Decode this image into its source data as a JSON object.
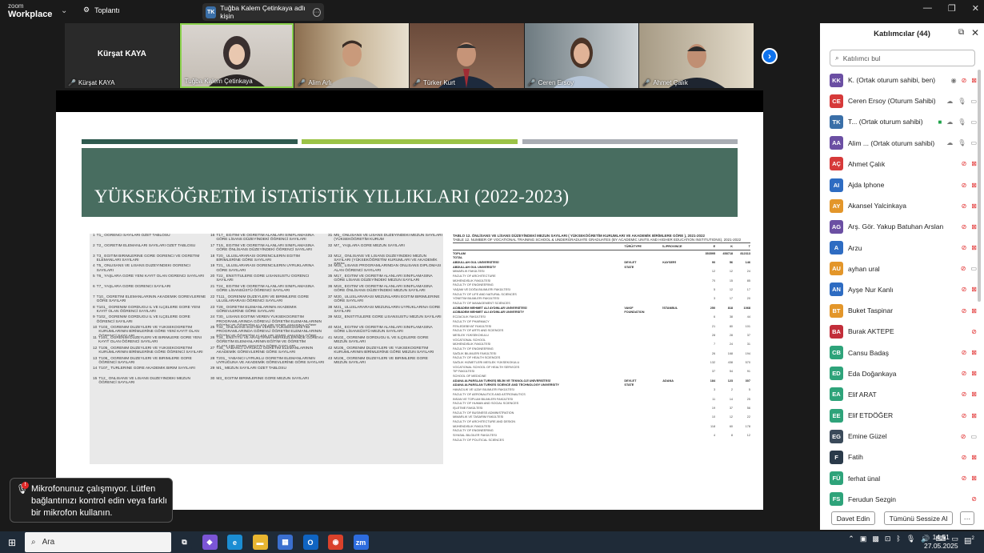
{
  "app": {
    "brand_top": "zoom",
    "brand_bottom": "Workplace",
    "meeting_label": "Toplantı",
    "share_badge": "TK",
    "share_title": "Tuğba Kalem Çetinkaya adlı kişin"
  },
  "video_strip": {
    "tiles": [
      {
        "big_name": "Kürşat KAYA",
        "name": "Kürşat KAYA",
        "type": "name-only"
      },
      {
        "big_name": "",
        "name": "Tuğba Kalem Çetinkaya",
        "type": "video",
        "active": true
      },
      {
        "big_name": "",
        "name": "Alim Arlı",
        "type": "video"
      },
      {
        "big_name": "",
        "name": "Türker Kurt",
        "type": "video"
      },
      {
        "big_name": "",
        "name": "Ceren Ersoy",
        "type": "video"
      },
      {
        "big_name": "",
        "name": "Ahmet Çalık",
        "type": "video"
      }
    ]
  },
  "slide": {
    "title": "YÜKSEKÖĞRETİM İSTATİSTİK YILLIKLARI (2022-2023)",
    "bar_colors": [
      "#2f5a4f",
      "#9bc346",
      "#a9adb3"
    ],
    "toc": [
      [
        "1",
        "T1_ ÖĞRENCİ SAYILARI ÖZET TABLOSU"
      ],
      [
        "2",
        "T2_ ÖĞRETİM ELEMANLARI SAYILARI ÖZET TABLOSU"
      ],
      [
        "3",
        "T3_ EĞİTİM BİRİMLERİNE GÖRE ÖĞRENCİ VE ÖĞRETİM ELEMANLARI SAYILARI"
      ],
      [
        "4",
        "T5_ ÖNLİSANS VE LİSANS DÜZEYİNDEKİ ÖĞRENCİ SAYILARI"
      ],
      [
        "5",
        "T6_ YAŞLARA GÖRE YENİ KAYIT OLAN ÖĞRENCİ SAYILARI"
      ],
      [
        "6",
        "T7_ YAŞLARA GÖRE ÖĞRENCİ SAYILARI"
      ],
      [
        "7",
        "T10_ ÖĞRETİM ELEMANLARININ AKADEMİK GÖREVLERİNE GÖRE SAYILARI"
      ],
      [
        "8",
        "T101_ ÖĞRENİM GÖRDÜĞÜ İL VE İLÇELERE GÖRE YENİ KAYIT OLAN ÖĞRENCİ SAYILARI"
      ],
      [
        "9",
        "T102_ ÖĞRENİM GÖRDÜĞÜ İL VE İLÇELERE GÖRE ÖĞRENCİ SAYILARI"
      ],
      [
        "10",
        "T103_ ÖĞRENİM DÜZEYLERİ VE YÜKSEKÖĞRETİM KURUMLARININ BİRİMLERİNE GÖRE YENİ KAYIT OLAN ÖĞRENCİ SAYILARI"
      ],
      [
        "11",
        "T104_ ÖĞRENİM DÜZEYLERİ VE BİRİMLERE GÖRE YENİ KAYIT OLAN ÖĞRENCİ SAYILARI"
      ],
      [
        "12",
        "T105_ ÖĞRENİM DÜZEYLERİ VE YÜKSEKÖĞRETİM KURUMLARININ BİRİMLERİNE GÖRE ÖĞRENCİ SAYILARI"
      ],
      [
        "13",
        "T106_ ÖĞRENİM DÜZEYLERİ VE BİRİMLERE GÖRE ÖĞRENCİ SAYILARI"
      ],
      [
        "14",
        "T107_ TÜRLERİNE GÖRE AKADEMİK BİRİM SAYILARI"
      ],
      [
        "15",
        "T12_ ÖNLİSANS VE LİSANS DÜZEYİNDEKİ MEZUN ÖĞRENCİ SAYILARI"
      ],
      [
        "16",
        "T17_ EĞİTİM VE ÖĞRETİM ALANLARI SINIFLAMASINA GÖRE LİSANS DÜZEYİNDEKİ ÖĞRENCİ SAYILARI"
      ],
      [
        "17",
        "T19_ EĞİTİM VE ÖĞRETİM ALANLARI SINIFLAMASINA GÖRE ÖNLİSANS DÜZEYİNDEKİ ÖĞRENCİ SAYILARI"
      ],
      [
        "18",
        "T20_ ULUSLARARASI ÖĞRENCİLERİN EĞİTİM BİRİMLERİNE GÖRE SAYILARI"
      ],
      [
        "19",
        "T21_ ULUSLARARASI ÖĞRENCİLERİN UYRUKLARINA GÖRE SAYILARI"
      ],
      [
        "20",
        "T22_ ENSTİTÜLERE GÖRE LİSANSÜSTÜ ÖĞRENCİ SAYILARI"
      ],
      [
        "21",
        "T24_ EĞİTİM VE ÖĞRETİM ALANLARI SINIFLAMASINA GÖRE LİSANSÜSTÜ ÖĞRENCİ SAYILARI"
      ],
      [
        "22",
        "T111_ ÖĞRENİM DÜZEYLERİ VE BİRİMLERE GÖRE ULUSLARARASI ÖĞRENCİ SAYILARI"
      ],
      [
        "23",
        "T28_ ÖĞRETİM ELEMANLARININ AKADEMİK GÖREVLERİNE GÖRE SAYILARI"
      ],
      [
        "24",
        "T30_ LİSANS EĞİTİMİ VEREN YÜKSEKÖĞRETİM PROGRAMLARINDA GÖREVLİ ÖĞRETİM ELEMANLARININ EĞİTİM VE ÖĞRETİM ALANLARI SINIFLAMASINA GÖRE SAYILARI"
      ],
      [
        "25",
        "T32_ ÖNLİSANS EĞİTİMİ VEREN YÜKSEKÖĞRETİM PROGRAMLARINDA GÖREVLİ ÖĞRETİM ELEMANLARININ EĞİTİM VE ÖĞRETİM ALANLARI SINIFLAMASINA GÖRE SAYILARI"
      ],
      [
        "26",
        "T34_ ENSTİTÜ VE ARAŞTIRMA MERKEZLERİNDE GÖREVLİ ÖĞRETİM ELEMANLARININ EĞİTİM VE ÖĞRETİM ALANLARI SINIFLAMASINA GÖRE SAYILARI"
      ],
      [
        "27",
        "T35_ YABANCI UYRUKLU ÖĞRETİM ELEMANLARININ AKADEMİK GÖREVLERİNE GÖRE SAYILARI"
      ],
      [
        "28",
        "T201_ YABANCI UYRUKLU ÖĞRETİM ELEMANLARININ UYRUĞUNA VE AKADEMİK GÖREVLERİNE GÖRE SAYILARI"
      ],
      [
        "29",
        "M1_ MEZUN SAYILARI ÖZET TABLOSU"
      ],
      [
        "30",
        "M3_ EĞİTİM BİRİMLERİNE GÖRE MEZUN SAYILARI"
      ],
      [
        "31",
        "M5_ ÖNLİSANS VE LİSANS DÜZEYİNDEKİ MEZUN SAYILARI (YÜKSEKÖĞRETİM KURUM"
      ],
      [
        "32",
        "M7_ YAŞLARA GÖRE MEZUN SAYILARI"
      ],
      [
        "33",
        "M12_ ÖNLİSANS VE LİSANS DÜZEYİNDEKİ MEZUN SAYILARI (YÜKSEKÖĞRETİM KURUMLARI VE AKADEMİK BİRİM"
      ],
      [
        "34",
        "M15_ LİSANS PROGRAMLARINDAN ÖNLİSANS DİPLOMASI ALAN ÖĞRENCİ SAYILARI"
      ],
      [
        "35",
        "M17_ EĞİTİM VE ÖĞRETİM ALANLARI SINIFLAMASINA GÖRE LİSANS DÜZEYİNDEKİ MEZUN SAYILARI"
      ],
      [
        "36",
        "M19_ EĞİTİM VE ÖĞRETİM ALANLARI SINIFLAMASINA GÖRE ÖNLİSANS DÜZEYİNDEKİ MEZUN SAYILARI"
      ],
      [
        "37",
        "M20_ ULUSLARARASI MEZUNLARIN EĞİTİM BİRİMLERİNE GÖRE SAYILARI"
      ],
      [
        "38",
        "M21_ ULUSLARARASI MEZUNLARIN UYRUKLARINA GÖRE SAYILARI"
      ],
      [
        "39",
        "M22_ ENSTİTÜLERE GÖRE LİSANSÜSTÜ MEZUN SAYILARI"
      ],
      [
        "40",
        "M24_ EĞİTİM VE ÖĞRETİM ALANLARI SINIFLAMASINA GÖRE LİSANSÜSTÜ MEZUN SAYILARI"
      ],
      [
        "41",
        "M102_ ÖĞRENİM GÖRDÜĞÜ İL VE İLÇELERE GÖRE MEZUN SAYILARI"
      ],
      [
        "42",
        "M105_ ÖĞRENİM DÜZEYLERİ VE YÜKSEKÖĞRETİM KURUMLARININ BİRİMLERİNE GÖRE MEZUN SAYILARI"
      ],
      [
        "43",
        "M106_ ÖĞRENİM DÜZEYLERİ VE BİRİMLERE GÖRE MEZUN SAYILARI"
      ]
    ],
    "stats_title_tr": "TABLO 12. ÖNLİSANS VE LİSANS DÜZEYİNDEKİ MEZUN SAYILARI ( YÜKSEKÖĞRETİM KURUMLARI VE AKADEMİK BİRİMLERE GÖRE ), 2021-2022",
    "stats_title_en": "TABLE 12. NUMBER OF VOCATIONAL TRAINING SCHOOL & UNDERGRADUATE GRADUATES (BY ACADEMIC UNITS AND HIGHER EDUCATION INSTITUTIONS), 2021-2022",
    "stats_headers": [
      "",
      "TÜRÜ/TYPE",
      "İL/PROVINCE",
      "E",
      "K",
      "T"
    ],
    "stats_rows": [
      {
        "c": [
          "TOPLAM",
          "",
          "",
          "353595",
          "458718",
          "812313"
        ],
        "hl": true
      },
      {
        "c": [
          "TOTAL",
          "",
          "",
          "",
          "",
          ""
        ],
        "hl": true
      },
      {
        "c": [
          "ABDULLAH GÜL ÜNİVERSİTESİ",
          "DEVLET",
          "KAYSERİ",
          "90",
          "56",
          "146"
        ],
        "hl": true
      },
      {
        "c": [
          "ABDULLAH GUL UNIVERSITY",
          "STATE",
          "",
          "",
          "",
          ""
        ],
        "hl": true
      },
      {
        "c": [
          "MİMARLIK FAKÜLTESİ",
          "",
          "",
          "12",
          "12",
          "24"
        ]
      },
      {
        "c": [
          "FACULTY OF ARCHITECTURE",
          "",
          "",
          "",
          "",
          ""
        ]
      },
      {
        "c": [
          "MÜHENDİSLİK FAKÜLTESİ",
          "",
          "",
          "70",
          "15",
          "85"
        ]
      },
      {
        "c": [
          "FACULTY OF ENGINEERING",
          "",
          "",
          "",
          "",
          ""
        ]
      },
      {
        "c": [
          "YAŞAM VE DOĞA BİLİMLERİ FAKÜLTESİ",
          "",
          "",
          "5",
          "12",
          "17"
        ]
      },
      {
        "c": [
          "FACULTY OF LIFE AND NATURAL SCIENCES",
          "",
          "",
          "",
          "",
          ""
        ]
      },
      {
        "c": [
          "YÖNETİM BİLİMLERİ FAKÜLTESİ",
          "",
          "",
          "3",
          "17",
          "20"
        ]
      },
      {
        "c": [
          "FACULTY OF MANAGEMENT SCIENCES",
          "",
          "",
          "",
          "",
          ""
        ]
      },
      {
        "c": [
          "ACIBADEM MEHMET ALİ AYDINLAR ÜNİVERSİTESİ",
          "VAKIF",
          "İSTANBUL",
          "250",
          "818",
          "1068"
        ],
        "hl": true
      },
      {
        "c": [
          "ACIBADEM MEHMET ALI AYDINLAR UNIVERSITY",
          "FOUNDATION",
          "",
          "",
          "",
          ""
        ],
        "hl": true
      },
      {
        "c": [
          "ECZACILIK FAKÜLTESİ",
          "",
          "",
          "6",
          "38",
          "44"
        ]
      },
      {
        "c": [
          "FACULTY OF PHARMACY",
          "",
          "",
          "",
          "",
          ""
        ]
      },
      {
        "c": [
          "FEN-EDEBİYAT FAKÜLTESİ",
          "",
          "",
          "21",
          "80",
          "101"
        ]
      },
      {
        "c": [
          "FACULTY OF ARTS AND SCIENCES",
          "",
          "",
          "",
          "",
          ""
        ]
      },
      {
        "c": [
          "MESLEK YÜKSEKOKULU",
          "",
          "",
          "28",
          "28",
          "37"
        ]
      },
      {
        "c": [
          "VOCATIONAL SCHOOL",
          "",
          "",
          "",
          "",
          ""
        ]
      },
      {
        "c": [
          "MÜHENDİSLİK FAKÜLTESİ",
          "",
          "",
          "7",
          "24",
          "31"
        ]
      },
      {
        "c": [
          "FACULTY OF ENGINEERING",
          "",
          "",
          "",
          "",
          ""
        ]
      },
      {
        "c": [
          "SAĞLIK BİLİMLERİ FAKÜLTESİ",
          "",
          "",
          "26",
          "168",
          "194"
        ]
      },
      {
        "c": [
          "FACULTY OF HEALTH SCIENCES",
          "",
          "",
          "",
          "",
          ""
        ]
      },
      {
        "c": [
          "SAĞLIK HİZMETLERİ MESLEK YÜKSEKOKULU",
          "",
          "",
          "132",
          "438",
          "570"
        ]
      },
      {
        "c": [
          "VOCATIONAL SCHOOL OF HEALTH SERVICES",
          "",
          "",
          "",
          "",
          ""
        ]
      },
      {
        "c": [
          "TIP FAKÜLTESİ",
          "",
          "",
          "37",
          "54",
          "91"
        ]
      },
      {
        "c": [
          "SCHOOL OF MEDICINE",
          "",
          "",
          "",
          "",
          ""
        ]
      },
      {
        "c": [
          "ADANA ALPARSLAN TÜRKEŞ BİLİM VE TEKNOLOJİ ÜNİVERSİTESİ",
          "DEVLET",
          "ADANA",
          "184",
          "123",
          "307"
        ],
        "hl": true
      },
      {
        "c": [
          "ADANA ALPARSLAN TURKES SCIENCE AND TECHNOLOGY UNIVERSITY",
          "STATE",
          "",
          "",
          "",
          ""
        ],
        "hl": true
      },
      {
        "c": [
          "HAVACILIK VE UZAY BİLİMLERİ FAKÜLTESİ",
          "",
          "",
          "3",
          "2",
          "5"
        ]
      },
      {
        "c": [
          "FACULTY OF AERONAUTICS AND ASTRONAUTICS",
          "",
          "",
          "",
          "",
          ""
        ]
      },
      {
        "c": [
          "İNSAN VE TOPLUM BİLİMLERİ FAKÜLTESİ",
          "",
          "",
          "11",
          "14",
          "25"
        ]
      },
      {
        "c": [
          "FACULTY OF HUMAN AND SOCIAL SCIENCES",
          "",
          "",
          "",
          "",
          ""
        ]
      },
      {
        "c": [
          "İŞLETME FAKÜLTESİ",
          "",
          "",
          "19",
          "37",
          "56"
        ]
      },
      {
        "c": [
          "FACULTY OF BUSINESS ADMINISTRATION",
          "",
          "",
          "",
          "",
          ""
        ]
      },
      {
        "c": [
          "MİMARLIK VE TASARIM FAKÜLTESİ",
          "",
          "",
          "10",
          "12",
          "22"
        ]
      },
      {
        "c": [
          "FACULTY OF ARCHITECTURE AND DESIGN",
          "",
          "",
          "",
          "",
          ""
        ]
      },
      {
        "c": [
          "MÜHENDİSLİK FAKÜLTESİ",
          "",
          "",
          "118",
          "60",
          "178"
        ]
      },
      {
        "c": [
          "FACULTY OF ENGINEERING",
          "",
          "",
          "",
          "",
          ""
        ]
      },
      {
        "c": [
          "SİYASAL BİLGİLER FAKÜLTESİ",
          "",
          "",
          "4",
          "8",
          "12"
        ]
      },
      {
        "c": [
          "FACULTY OF POLITICAL SCIENCES",
          "",
          "",
          "",
          "",
          ""
        ]
      }
    ]
  },
  "toast": {
    "badge": "!",
    "text": "Mikrofonunuz çalışmıyor. Lütfen bağlantınızı kontrol edin veya farklı bir mikrofon kullanın."
  },
  "participants": {
    "title": "Katılımcılar (44)",
    "search_placeholder": "Katılımcı bul",
    "items": [
      {
        "initials": "KK",
        "name": "K. (Ortak oturum sahibi, ben)",
        "color": "#6b4fa3",
        "icons": [
          "eye",
          "mute",
          "cam-off"
        ]
      },
      {
        "initials": "CE",
        "name": "Ceren Ersoy (Oturum Sahibi)",
        "color": "#d63a3a",
        "icons": [
          "cloud",
          "mic",
          "cam"
        ]
      },
      {
        "initials": "TK",
        "name": "T... (Ortak oturum sahibi)",
        "color": "#3a6fa8",
        "icons": [
          "share",
          "cloud",
          "mic",
          "cam"
        ]
      },
      {
        "initials": "AA",
        "name": "Alim ... (Ortak oturum sahibi)",
        "color": "#6b4fa3",
        "icons": [
          "cloud",
          "mic",
          "cam"
        ]
      },
      {
        "initials": "AÇ",
        "name": "Ahmet Çalık",
        "color": "#d63a3a",
        "icons": [
          "mute",
          "cam-off"
        ]
      },
      {
        "initials": "AI",
        "name": "Ajda Iphone",
        "color": "#2e6cc2",
        "icons": [
          "mute",
          "cam-off"
        ]
      },
      {
        "initials": "AY",
        "name": "Akansel Yalcinkaya",
        "color": "#e3962a",
        "icons": [
          "mute",
          "cam-off"
        ]
      },
      {
        "initials": "AG",
        "name": "Arş. Gör. Yakup Batuhan Arslan",
        "color": "#6b4fa3",
        "icons": [
          "mute",
          "cam-off"
        ]
      },
      {
        "initials": "A",
        "name": "Arzu",
        "color": "#2e6cc2",
        "icons": [
          "mute",
          "cam-off"
        ]
      },
      {
        "initials": "AU",
        "name": "ayhan ural",
        "color": "#e3962a",
        "icons": [
          "mute",
          "cam"
        ]
      },
      {
        "initials": "AN",
        "name": "Ayşe Nur Kanlı",
        "color": "#2e6cc2",
        "icons": [
          "mute",
          "cam-off"
        ]
      },
      {
        "initials": "BT",
        "name": "Buket Taspinar",
        "color": "#e3962a",
        "icons": [
          "mute",
          "cam-off"
        ]
      },
      {
        "initials": "BA",
        "name": "Burak AKTEPE",
        "color": "#c22e3a",
        "icons": [
          "mute"
        ]
      },
      {
        "initials": "CB",
        "name": "Cansu Badaş",
        "color": "#2ea37a",
        "icons": [
          "mute",
          "cam-off"
        ]
      },
      {
        "initials": "ED",
        "name": "Eda Doğankaya",
        "color": "#2ea37a",
        "icons": [
          "mute",
          "cam-off"
        ]
      },
      {
        "initials": "EA",
        "name": "Elif ARAT",
        "color": "#2ea37a",
        "icons": [
          "mute",
          "cam-off"
        ]
      },
      {
        "initials": "EE",
        "name": "Elif ETDÖĞER",
        "color": "#2ea37a",
        "icons": [
          "mute",
          "cam-off"
        ]
      },
      {
        "initials": "EG",
        "name": "Emine Güzel",
        "color": "#3a4a5a",
        "icons": [
          "mute",
          "cam"
        ]
      },
      {
        "initials": "F",
        "name": "Fatih",
        "color": "#2a3a4a",
        "icons": [
          "mute",
          "cam-off"
        ]
      },
      {
        "initials": "FÜ",
        "name": "ferhat ünal",
        "color": "#2ea37a",
        "icons": [
          "mute",
          "cam-off"
        ]
      },
      {
        "initials": "FS",
        "name": "Ferudun Sezgin",
        "color": "#2ea37a",
        "icons": [
          "mute"
        ]
      }
    ],
    "invite_label": "Davet Edin",
    "mute_all_label": "Tümünü Sessize Al",
    "more_label": "···"
  },
  "taskbar": {
    "search_label": "Ara",
    "time": "14:51",
    "date": "27.05.2025",
    "notification_count": "2",
    "apps": [
      {
        "name": "task-view",
        "glyph": "⧉",
        "color": "#1f2b38"
      },
      {
        "name": "copilot",
        "glyph": "◆",
        "color": "#7b55d6"
      },
      {
        "name": "edge",
        "glyph": "e",
        "color": "#1b8dd3"
      },
      {
        "name": "file-explorer",
        "glyph": "▬",
        "color": "#e8b530"
      },
      {
        "name": "store",
        "glyph": "▦",
        "color": "#3a6fcf"
      },
      {
        "name": "outlook",
        "glyph": "O",
        "color": "#0f64c2"
      },
      {
        "name": "chrome",
        "glyph": "◉",
        "color": "#d9412b"
      },
      {
        "name": "zoom",
        "glyph": "zm",
        "color": "#2d6cdf"
      }
    ]
  }
}
